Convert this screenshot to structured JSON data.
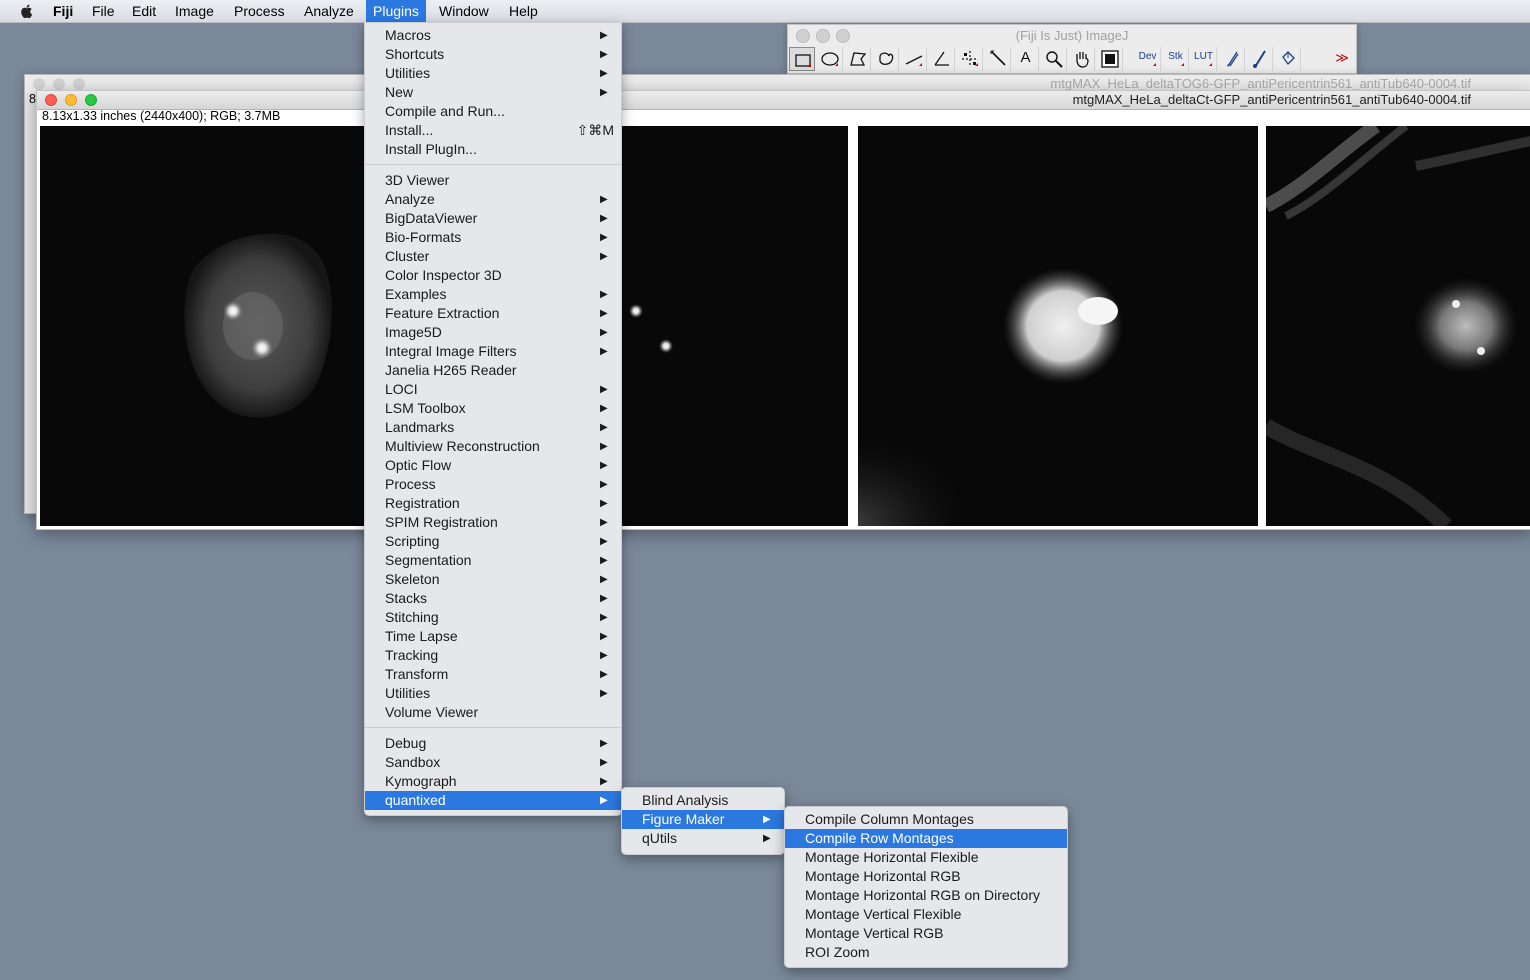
{
  "menubar": {
    "app": "Fiji",
    "items": [
      "File",
      "Edit",
      "Image",
      "Process",
      "Analyze",
      "Plugins",
      "Window",
      "Help"
    ],
    "active": "Plugins"
  },
  "toolbar_window": {
    "title": "(Fiji Is Just) ImageJ",
    "tools": [
      "rectangle-tool",
      "oval-tool",
      "polygon-tool",
      "freehand-tool",
      "line-tool",
      "angle-tool",
      "multipoint-tool",
      "wand-tool",
      "text-tool",
      "magnifier-tool",
      "hand-tool",
      "color-picker-tool",
      "spacer",
      "dev-tool",
      "stk-tool",
      "lut-tool",
      "pencil-tool",
      "brush-tool",
      "flood-fill-tool",
      "spacer",
      "more-tools"
    ],
    "tool_labels": {
      "dev": "Dev",
      "stk": "Stk",
      "lut": "LUT",
      "text": "A",
      "more": "≫"
    }
  },
  "back_window": {
    "title": "mtgMAX_HeLa_deltaTOG6-GFP_antiPericentrin561_antiTub640-0004.tif",
    "left_edge_char": "8"
  },
  "image_window": {
    "title": "mtgMAX_HeLa_deltaCt-GFP_antiPericentrin561_antiTub640-0004.tif",
    "info": "8.13x1.33 inches (2440x400); RGB; 3.7MB"
  },
  "plugins_menu": {
    "groups": [
      [
        {
          "label": "Macros",
          "sub": true
        },
        {
          "label": "Shortcuts",
          "sub": true
        },
        {
          "label": "Utilities",
          "sub": true
        },
        {
          "label": "New",
          "sub": true
        },
        {
          "label": "Compile and Run...",
          "sub": false
        },
        {
          "label": "Install...",
          "sub": false,
          "shortcut": "⇧⌘M"
        },
        {
          "label": "Install PlugIn...",
          "sub": false
        }
      ],
      [
        {
          "label": "3D Viewer",
          "sub": false
        },
        {
          "label": "Analyze",
          "sub": true
        },
        {
          "label": "BigDataViewer",
          "sub": true
        },
        {
          "label": "Bio-Formats",
          "sub": true
        },
        {
          "label": "Cluster",
          "sub": true
        },
        {
          "label": "Color Inspector 3D",
          "sub": false
        },
        {
          "label": "Examples",
          "sub": true
        },
        {
          "label": "Feature Extraction",
          "sub": true
        },
        {
          "label": "Image5D",
          "sub": true
        },
        {
          "label": "Integral Image Filters",
          "sub": true
        },
        {
          "label": "Janelia H265 Reader",
          "sub": false
        },
        {
          "label": "LOCI",
          "sub": true
        },
        {
          "label": "LSM Toolbox",
          "sub": true
        },
        {
          "label": "Landmarks",
          "sub": true
        },
        {
          "label": "Multiview Reconstruction",
          "sub": true
        },
        {
          "label": "Optic Flow",
          "sub": true
        },
        {
          "label": "Process",
          "sub": true
        },
        {
          "label": "Registration",
          "sub": true
        },
        {
          "label": "SPIM Registration",
          "sub": true
        },
        {
          "label": "Scripting",
          "sub": true
        },
        {
          "label": "Segmentation",
          "sub": true
        },
        {
          "label": "Skeleton",
          "sub": true
        },
        {
          "label": "Stacks",
          "sub": true
        },
        {
          "label": "Stitching",
          "sub": true
        },
        {
          "label": "Time Lapse",
          "sub": true
        },
        {
          "label": "Tracking",
          "sub": true
        },
        {
          "label": "Transform",
          "sub": true
        },
        {
          "label": "Utilities",
          "sub": true
        },
        {
          "label": "Volume Viewer",
          "sub": false
        }
      ],
      [
        {
          "label": "Debug",
          "sub": true
        },
        {
          "label": "Sandbox",
          "sub": true
        },
        {
          "label": "Kymograph",
          "sub": true
        },
        {
          "label": "quantixed",
          "sub": true,
          "highlighted": true
        }
      ]
    ]
  },
  "quantixed_menu": {
    "items": [
      {
        "label": "Blind Analysis",
        "sub": false
      },
      {
        "label": "Figure Maker",
        "sub": true,
        "highlighted": true
      },
      {
        "label": "qUtils",
        "sub": true
      }
    ]
  },
  "figure_maker_menu": {
    "items": [
      {
        "label": "Compile Column Montages"
      },
      {
        "label": "Compile Row Montages",
        "highlighted": true
      },
      {
        "label": "Montage Horizontal Flexible"
      },
      {
        "label": "Montage Horizontal RGB"
      },
      {
        "label": "Montage Horizontal RGB on Directory"
      },
      {
        "label": "Montage Vertical Flexible"
      },
      {
        "label": "Montage Vertical RGB"
      },
      {
        "label": "ROI Zoom"
      }
    ]
  },
  "colors": {
    "desktop": "#7a8899",
    "highlight": "#2b78e0",
    "menu_bg": "#e5e7ea"
  }
}
